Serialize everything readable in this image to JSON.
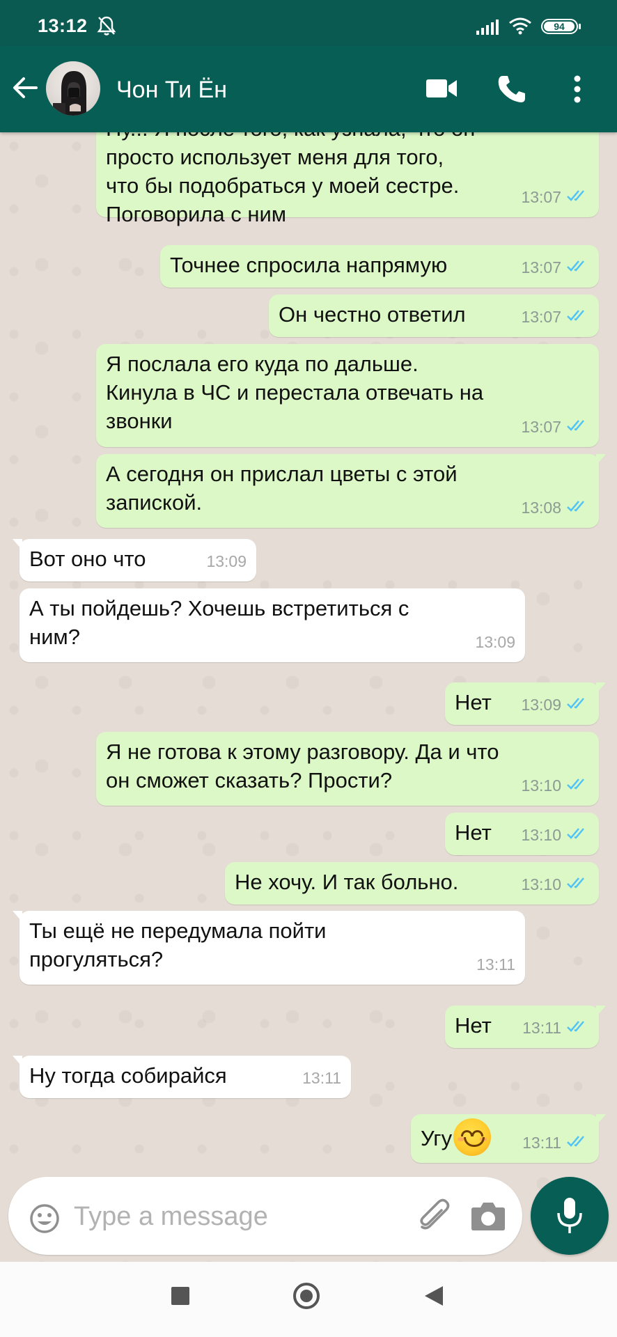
{
  "status_bar": {
    "time": "13:12",
    "battery": "94",
    "icons": [
      "bell-off-icon",
      "signal-icon",
      "wifi-icon",
      "battery-icon"
    ]
  },
  "header": {
    "contact_name": "Чон Ти Ён",
    "icons": [
      "back-arrow-icon",
      "avatar",
      "video-call-icon",
      "phone-icon",
      "more-vert-icon"
    ]
  },
  "messages": [
    {
      "dir": "out",
      "text": "Ну... Я после того, как узнала, что он\nпросто использует меня для того,\nчто бы подобраться у моей сестре.\nПоговорила с ним",
      "time": "13:07",
      "status": "read"
    },
    {
      "dir": "out",
      "text": "Точнее спросила напрямую",
      "time": "13:07",
      "status": "read"
    },
    {
      "dir": "out",
      "text": "Он честно ответил",
      "time": "13:07",
      "status": "read"
    },
    {
      "dir": "out",
      "text": "Я послала его куда по дальше.\nКинула в ЧС и перестала отвечать на\nзвонки",
      "time": "13:07",
      "status": "read"
    },
    {
      "dir": "out",
      "text": "А сегодня он прислал цветы с этой\nзапиской.",
      "time": "13:08",
      "status": "read"
    },
    {
      "dir": "in",
      "text": "Вот оно что",
      "time": "13:09"
    },
    {
      "dir": "in",
      "text": "А ты пойдешь? Хочешь встретиться с\nним?",
      "time": "13:09"
    },
    {
      "dir": "out",
      "text": "Нет",
      "time": "13:09",
      "status": "read"
    },
    {
      "dir": "out",
      "text": "Я не готова к этому разговору. Да и что\nон сможет сказать? Прости?",
      "time": "13:10",
      "status": "read"
    },
    {
      "dir": "out",
      "text": "Нет",
      "time": "13:10",
      "status": "read"
    },
    {
      "dir": "out",
      "text": "Не хочу. И так больно.",
      "time": "13:10",
      "status": "read"
    },
    {
      "dir": "in",
      "text": "Ты ещё не передумала пойти\nпрогуляться?",
      "time": "13:11"
    },
    {
      "dir": "out",
      "text": "Нет",
      "time": "13:11",
      "status": "read"
    },
    {
      "dir": "in",
      "text": "Ну тогда собирайся",
      "time": "13:11"
    },
    {
      "dir": "out",
      "text": "Угу",
      "emoji": "smiling-face-emoji",
      "time": "13:11",
      "status": "read"
    }
  ],
  "composer": {
    "placeholder": "Type a message",
    "icons": [
      "emoji-icon",
      "attach-icon",
      "camera-icon",
      "mic-icon"
    ]
  },
  "colors": {
    "header": "#075e54",
    "status_bar": "#0b5a52",
    "outgoing_bubble": "#dcf8c6",
    "incoming_bubble": "#ffffff",
    "read_ticks": "#4fc3f7"
  }
}
